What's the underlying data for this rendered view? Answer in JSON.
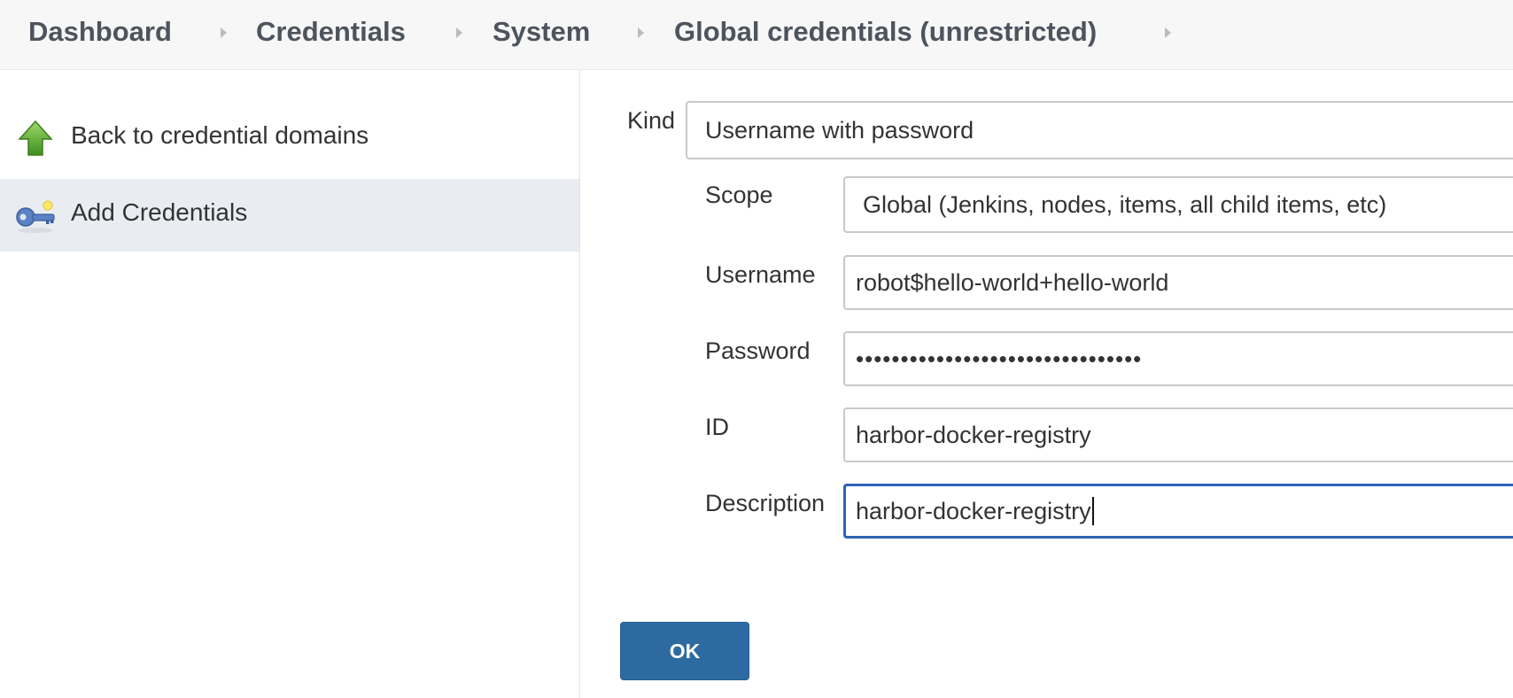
{
  "breadcrumb": {
    "items": [
      "Dashboard",
      "Credentials",
      "System",
      "Global credentials (unrestricted)"
    ]
  },
  "sidebar": {
    "items": [
      {
        "label": "Back to credential domains",
        "icon": "up-arrow-icon",
        "active": false
      },
      {
        "label": "Add Credentials",
        "icon": "key-icon",
        "active": true
      }
    ]
  },
  "form": {
    "kind": {
      "label": "Kind",
      "value": "Username with password"
    },
    "scope": {
      "label": "Scope",
      "value": "Global (Jenkins, nodes, items, all child items, etc)"
    },
    "username": {
      "label": "Username",
      "value": "robot$hello-world+hello-world"
    },
    "password": {
      "label": "Password",
      "value": "••••••••••••••••••••••••••••••••"
    },
    "id": {
      "label": "ID",
      "value": "harbor-docker-registry"
    },
    "description": {
      "label": "Description",
      "value": "harbor-docker-registry"
    }
  },
  "actions": {
    "ok_label": "OK"
  },
  "colors": {
    "accent": "#2d6aa2",
    "focus_border": "#2e62b7",
    "active_sidebar": "#e9edf1"
  }
}
